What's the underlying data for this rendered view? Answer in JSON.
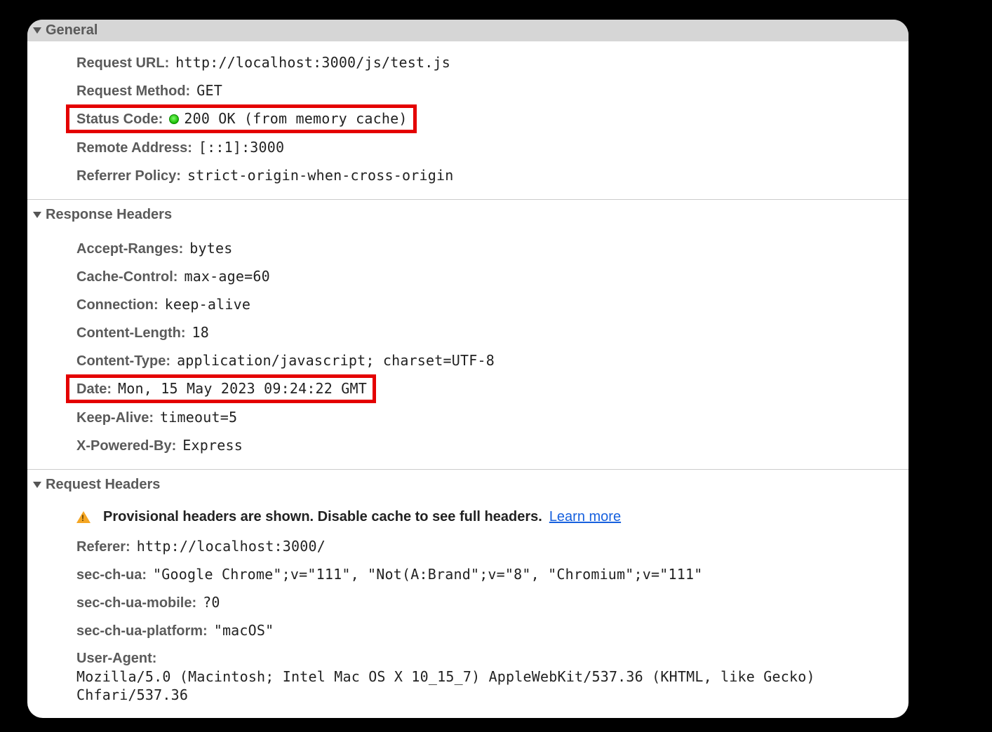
{
  "sections": {
    "general": {
      "title": "General"
    },
    "response": {
      "title": "Response Headers"
    },
    "request": {
      "title": "Request Headers"
    }
  },
  "general": {
    "request_url": {
      "label": "Request URL:",
      "value": "http://localhost:3000/js/test.js"
    },
    "request_method": {
      "label": "Request Method:",
      "value": "GET"
    },
    "status_code": {
      "label": "Status Code:",
      "value": "200 OK (from memory cache)"
    },
    "remote_address": {
      "label": "Remote Address:",
      "value": "[::1]:3000"
    },
    "referrer_policy": {
      "label": "Referrer Policy:",
      "value": "strict-origin-when-cross-origin"
    }
  },
  "response": {
    "accept_ranges": {
      "label": "Accept-Ranges:",
      "value": "bytes"
    },
    "cache_control": {
      "label": "Cache-Control:",
      "value": "max-age=60"
    },
    "connection": {
      "label": "Connection:",
      "value": "keep-alive"
    },
    "content_length": {
      "label": "Content-Length:",
      "value": "18"
    },
    "content_type": {
      "label": "Content-Type:",
      "value": "application/javascript; charset=UTF-8"
    },
    "date": {
      "label": "Date:",
      "value": "Mon, 15 May 2023 09:24:22 GMT"
    },
    "keep_alive": {
      "label": "Keep-Alive:",
      "value": "timeout=5"
    },
    "x_powered_by": {
      "label": "X-Powered-By:",
      "value": "Express"
    }
  },
  "request": {
    "warning_text": "Provisional headers are shown. Disable cache to see full headers.",
    "learn_more": "Learn more",
    "referer": {
      "label": "Referer:",
      "value": "http://localhost:3000/"
    },
    "sec_ch_ua": {
      "label": "sec-ch-ua:",
      "value": "\"Google Chrome\";v=\"111\", \"Not(A:Brand\";v=\"8\", \"Chromium\";v=\"111\""
    },
    "sec_ch_ua_mobile": {
      "label": "sec-ch-ua-mobile:",
      "value": "?0"
    },
    "sec_ch_ua_platform": {
      "label": "sec-ch-ua-platform:",
      "value": "\"macOS\""
    },
    "user_agent": {
      "label": "User-Agent:",
      "value": "Mozilla/5.0 (Macintosh; Intel Mac OS X 10_15_7) AppleWebKit/537.36 (KHTML, like Gecko) Chfari/537.36"
    }
  }
}
